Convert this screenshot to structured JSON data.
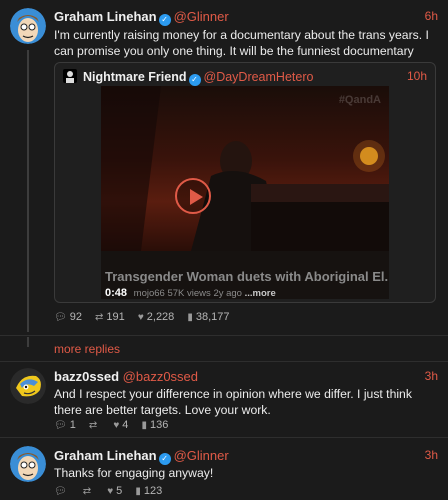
{
  "tweets": [
    {
      "name": "Graham Linehan",
      "handle": "@Glinner",
      "time": "6h",
      "text": "I'm currently raising money for a documentary about the trans years. I can promise you only one thing. It will be the funniest documentary ever made.",
      "replies": "92",
      "retweets": "191",
      "likes": "2,228",
      "views": "38,177"
    },
    {
      "name": "bazz0ssed",
      "handle": "@bazz0ssed",
      "time": "3h",
      "text": "And I respect your difference in opinion where we differ. I just think there are better targets. Love your work.",
      "replies": "1",
      "retweets": "",
      "likes": "4",
      "views": "136"
    },
    {
      "name": "Graham Linehan",
      "handle": "@Glinner",
      "time": "3h",
      "text": "Thanks for engaging anyway!",
      "replies": "",
      "retweets": "",
      "likes": "5",
      "views": "123"
    }
  ],
  "quote": {
    "name": "Nightmare Friend",
    "handle": "@DayDreamHetero",
    "time": "10h",
    "video": {
      "title": "Transgender Woman duets with Aboriginal El...",
      "duration": "0:48",
      "channel": "mojo66",
      "views": "57K views",
      "age": "2y ago",
      "more": "...more",
      "hashtag": "#QandA"
    }
  },
  "more_replies": "more replies",
  "icons": {
    "reply": "speech-bubble-icon",
    "retweet": "retweet-icon",
    "like": "heart-icon",
    "views": "bar-chart-icon",
    "verified": "verified-badge-icon"
  },
  "colors": {
    "accent": "#e05a47",
    "verified": "#2c9bf0",
    "background": "#1b1b1b"
  }
}
